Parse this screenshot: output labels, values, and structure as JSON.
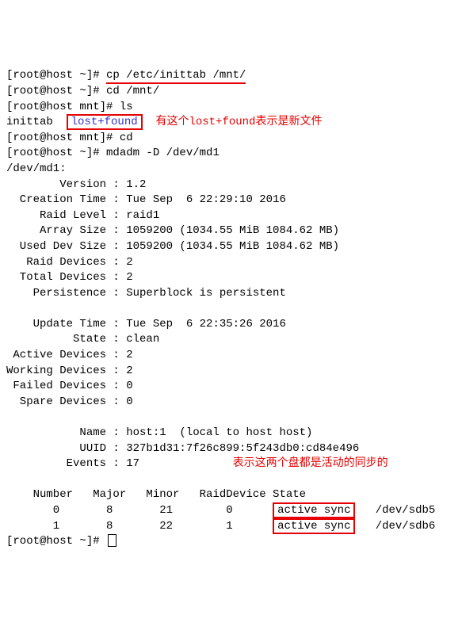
{
  "l1_prompt": "[root@host ~]# ",
  "l1_cmd": "cp /etc/inittab /mnt/",
  "l2": "[root@host ~]# cd /mnt/",
  "l3": "[root@host mnt]# ls",
  "l4_a": "inittab  ",
  "l4_b": "lost+found",
  "l4_note": "  有这个lost+found表示是新文件",
  "l5": "[root@host mnt]# cd",
  "l6": "[root@host ~]# mdadm -D /dev/md1",
  "l7": "/dev/md1:",
  "l8": "        Version : 1.2",
  "l9": "  Creation Time : Tue Sep  6 22:29:10 2016",
  "l10": "     Raid Level : raid1",
  "l11": "     Array Size : 1059200 (1034.55 MiB 1084.62 MB)",
  "l12": "  Used Dev Size : 1059200 (1034.55 MiB 1084.62 MB)",
  "l13": "   Raid Devices : 2",
  "l14": "  Total Devices : 2",
  "l15": "    Persistence : Superblock is persistent",
  "l16": "",
  "l17": "    Update Time : Tue Sep  6 22:35:26 2016",
  "l18": "          State : clean",
  "l19": " Active Devices : 2",
  "l20": "Working Devices : 2",
  "l21": " Failed Devices : 0",
  "l22": "  Spare Devices : 0",
  "l23": "",
  "l24": "           Name : host:1  (local to host host)",
  "l25": "           UUID : 327b1d31:7f26c899:5f243db0:cd84e496",
  "l26": "         Events : 17",
  "l26_note": "              表示这两个盘都是活动的同步的",
  "l27": "",
  "l28": "    Number   Major   Minor   RaidDevice State",
  "l29a": "       0       8       21        0      ",
  "l29b": "active sync",
  "l29c": "   /dev/sdb5",
  "l30a": "       1       8       22        1      ",
  "l30b": "active sync",
  "l30c": "   /dev/sdb6",
  "l31": "[root@host ~]# "
}
